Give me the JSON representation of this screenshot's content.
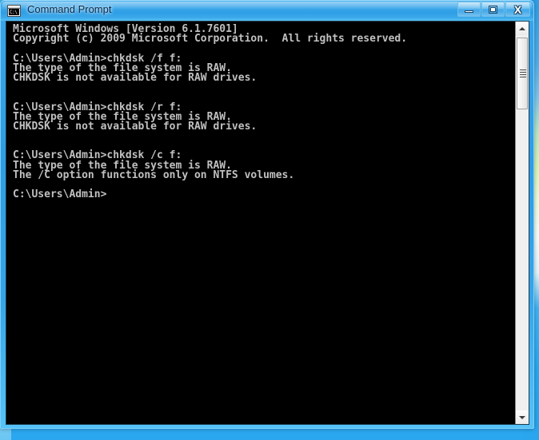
{
  "window": {
    "title": "Command Prompt",
    "icon_name": "cmd-prompt-icon",
    "icon_text": "C:\\",
    "buttons": {
      "minimize_label": "–",
      "maximize_label": "□",
      "close_label": "X"
    }
  },
  "console": {
    "background_color": "#000000",
    "text_color": "#c0c0c0",
    "lines": [
      "Microsoft Windows [Version 6.1.7601]",
      "Copyright (c) 2009 Microsoft Corporation.  All rights reserved.",
      "",
      "C:\\Users\\Admin>chkdsk /f f:",
      "The type of the file system is RAW.",
      "CHKDSK is not available for RAW drives.",
      "",
      "",
      "C:\\Users\\Admin>chkdsk /r f:",
      "The type of the file system is RAW.",
      "CHKDSK is not available for RAW drives.",
      "",
      "",
      "C:\\Users\\Admin>chkdsk /c f:",
      "The type of the file system is RAW.",
      "The /C option functions only on NTFS volumes.",
      "",
      "C:\\Users\\Admin>"
    ]
  },
  "scrollbar": {
    "up_arrow_name": "scroll-up-arrow",
    "down_arrow_name": "scroll-down-arrow"
  },
  "theme": {
    "titlebar_accent": "#2f9ce5",
    "window_border": "#7fcef8",
    "console_bg": "#000000",
    "console_fg": "#c0c0c0"
  }
}
